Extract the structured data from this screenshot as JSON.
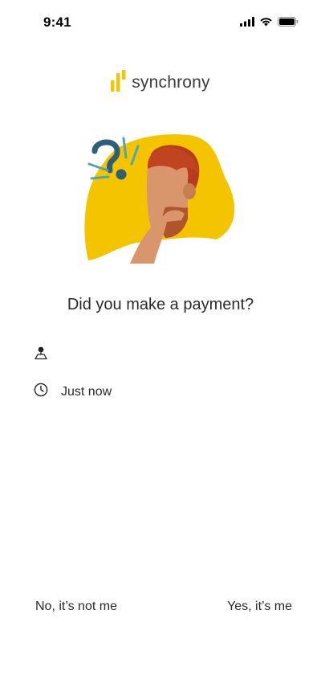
{
  "status_bar": {
    "time": "9:41"
  },
  "brand": {
    "name": "synchrony",
    "accent_color": "#F5C400"
  },
  "prompt": {
    "question": "Did you make a payment?"
  },
  "details": {
    "location_label": "",
    "time_label": "Just now"
  },
  "actions": {
    "deny_label": "No, it’s not me",
    "confirm_label": "Yes, it’s me"
  },
  "icons": {
    "location": "person-pin-icon",
    "time": "clock-icon"
  }
}
